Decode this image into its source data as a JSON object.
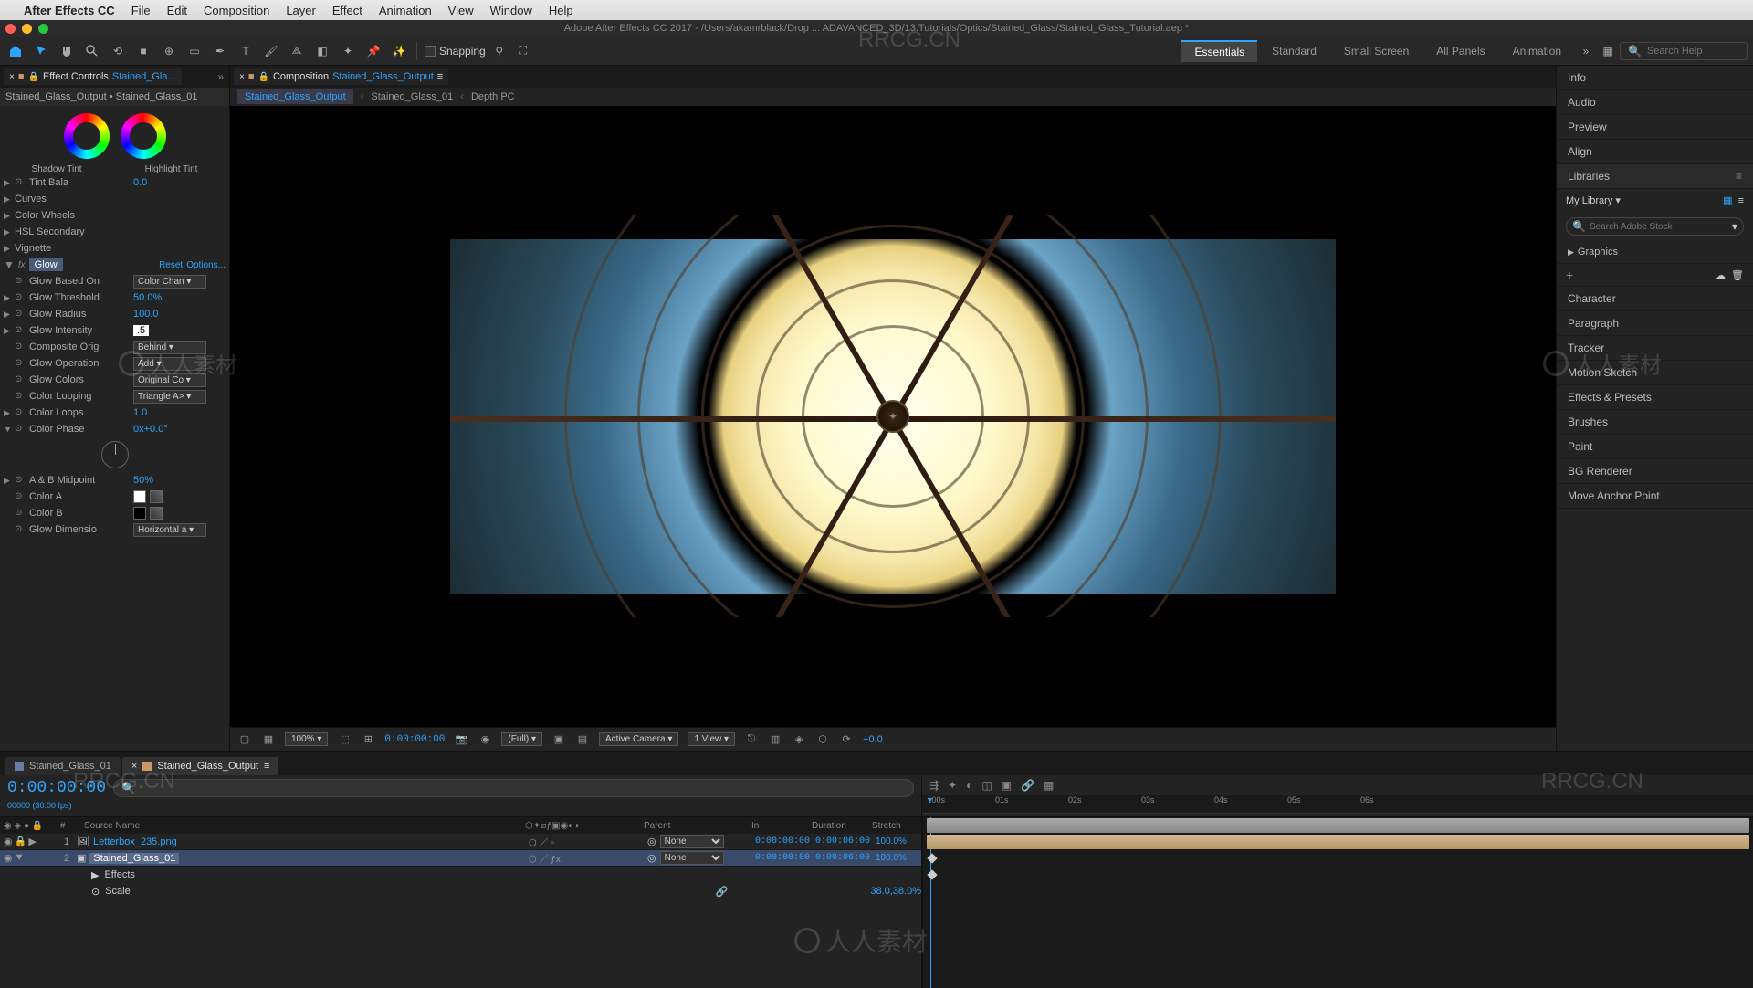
{
  "menubar": {
    "app": "After Effects CC",
    "items": [
      "File",
      "Edit",
      "Composition",
      "Layer",
      "Effect",
      "Animation",
      "View",
      "Window",
      "Help"
    ]
  },
  "title": "Adobe After Effects CC 2017 - /Users/akamrblack/Drop ... ADAVANCED_3D/13.Tutorials/Optics/Stained_Glass/Stained_Glass_Tutorial.aep *",
  "toolbar": {
    "snapping": "Snapping",
    "workspaces": [
      "Essentials",
      "Standard",
      "Small Screen",
      "All Panels",
      "Animation"
    ],
    "active_workspace": "Essentials",
    "search_placeholder": "Search Help"
  },
  "effect_panel": {
    "tab": "Effect Controls",
    "tab_comp": "Stained_Gla...",
    "crumb": "Stained_Glass_Output • Stained_Glass_01",
    "wheel_left": "Shadow Tint",
    "wheel_right": "Highlight Tint",
    "rows_top": [
      {
        "label": "Tint Bala",
        "val": "0.0"
      },
      {
        "label": "Curves"
      },
      {
        "label": "Color Wheels"
      },
      {
        "label": "HSL Secondary"
      },
      {
        "label": "Vignette"
      }
    ],
    "glow": {
      "name": "Glow",
      "reset": "Reset",
      "options": "Options...",
      "props": {
        "based_on": {
          "label": "Glow Based On",
          "val": "Color Chan"
        },
        "threshold": {
          "label": "Glow Threshold",
          "val": "50.0%"
        },
        "radius": {
          "label": "Glow Radius",
          "val": "100.0"
        },
        "intensity": {
          "label": "Glow Intensity",
          "val": ".5"
        },
        "composite": {
          "label": "Composite Orig",
          "val": "Behind"
        },
        "operation": {
          "label": "Glow Operation",
          "val": "Add"
        },
        "colors": {
          "label": "Glow Colors",
          "val": "Original Co"
        },
        "looping": {
          "label": "Color Looping",
          "val": "Triangle A>"
        },
        "loops": {
          "label": "Color Loops",
          "val": "1.0"
        },
        "phase": {
          "label": "Color Phase",
          "val": "0x+0.0°"
        },
        "midpoint": {
          "label": "A & B Midpoint",
          "val": "50%"
        },
        "color_a": {
          "label": "Color A"
        },
        "color_b": {
          "label": "Color B"
        },
        "dimension": {
          "label": "Glow Dimensio",
          "val": "Horizontal a"
        }
      }
    }
  },
  "comp_panel": {
    "tab_prefix": "Composition",
    "tab_comp": "Stained_Glass_Output",
    "crumbs": [
      "Stained_Glass_Output",
      "Stained_Glass_01",
      "Depth PC"
    ]
  },
  "viewer": {
    "zoom": "100%",
    "timecode": "0:00:00:00",
    "res": "(Full)",
    "camera": "Active Camera",
    "views": "1 View",
    "exposure": "+0.0"
  },
  "right_panel": {
    "items_top": [
      "Info",
      "Audio",
      "Preview",
      "Align"
    ],
    "libraries": "Libraries",
    "my_library": "My Library",
    "search_placeholder": "Search Adobe Stock",
    "graphics": "Graphics",
    "items_bot": [
      "Character",
      "Paragraph",
      "Tracker",
      "Motion Sketch",
      "Effects & Presets",
      "Brushes",
      "Paint",
      "BG Renderer",
      "Move Anchor Point"
    ]
  },
  "timeline": {
    "tabs": [
      "Stained_Glass_01",
      "Stained_Glass_Output"
    ],
    "active_tab": 1,
    "timecode": "0:00:00:00",
    "meta": "00000 (30.00 fps)",
    "cols": {
      "idx": "#",
      "src": "Source Name",
      "parent": "Parent",
      "in": "In",
      "dur": "Duration",
      "stretch": "Stretch"
    },
    "ruler": [
      ":00s",
      "01s",
      "02s",
      "03s",
      "04s",
      "05s",
      "06s"
    ],
    "layers": [
      {
        "idx": "1",
        "name": "Letterbox_235.png",
        "parent": "None",
        "in": "0:00:00:00",
        "dur": "0:00:06:00",
        "stretch": "100.0%"
      },
      {
        "idx": "2",
        "name": "Stained_Glass_01",
        "parent": "None",
        "in": "0:00:00:00",
        "dur": "0:00:06:00",
        "stretch": "100.0%",
        "selected": true
      }
    ],
    "sub_effects": "Effects",
    "sub_scale": "Scale",
    "scale_val": "38.0,38.0%"
  },
  "watermark": {
    "url": "RRCG.CN",
    "cn": "人人素材"
  }
}
